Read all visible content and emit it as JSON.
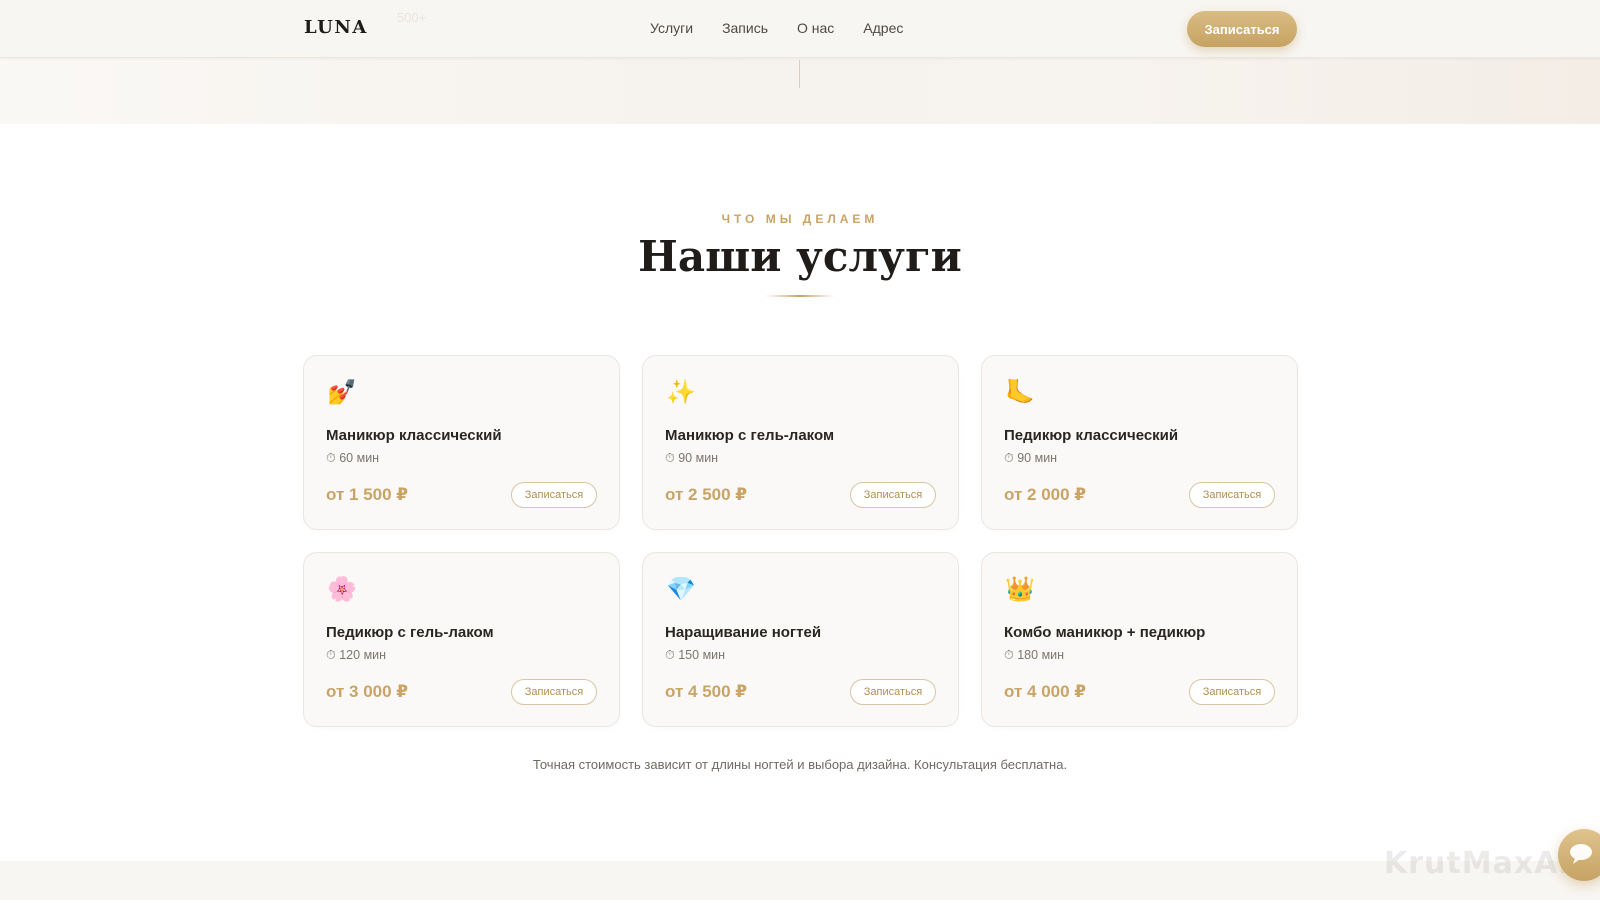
{
  "header": {
    "logo": "LUNA",
    "ghost_text": "500+",
    "nav": [
      "Услуги",
      "Запись",
      "О нас",
      "Адрес"
    ],
    "book_label": "Записаться"
  },
  "services": {
    "eyebrow": "ЧТО МЫ ДЕЛАЕМ",
    "title": "Наши услуги",
    "items": [
      {
        "icon": "nail-polish-icon",
        "glyph": "💅",
        "name": "Маникюр классический",
        "duration": "60 мин",
        "price": "от 1 500 ₽",
        "button": "Записаться"
      },
      {
        "icon": "sparkles-icon",
        "glyph": "✨",
        "name": "Маникюр с гель-лаком",
        "duration": "90 мин",
        "price": "от 2 500 ₽",
        "button": "Записаться"
      },
      {
        "icon": "foot-icon",
        "glyph": "🦶",
        "name": "Педикюр классический",
        "duration": "90 мин",
        "price": "от 2 000 ₽",
        "button": "Записаться"
      },
      {
        "icon": "flower-icon",
        "glyph": "🌸",
        "name": "Педикюр с гель-лаком",
        "duration": "120 мин",
        "price": "от 3 000 ₽",
        "button": "Записаться"
      },
      {
        "icon": "gem-icon",
        "glyph": "💎",
        "name": "Наращивание ногтей",
        "duration": "150 мин",
        "price": "от 4 500 ₽",
        "button": "Записаться"
      },
      {
        "icon": "crown-icon",
        "glyph": "👑",
        "name": "Комбо маникюр + педикюр",
        "duration": "180 мин",
        "price": "от 4 000 ₽",
        "button": "Записаться"
      }
    ],
    "note": "Точная стоимость зависит от длины ногтей и выбора дизайна. Консультация бесплатна."
  },
  "watermark": "KrutMaxAI",
  "colors": {
    "accent": "#c9a466",
    "accent_dark": "#b08f55",
    "text": "#2a2622",
    "card_bg": "#faf9f7"
  }
}
